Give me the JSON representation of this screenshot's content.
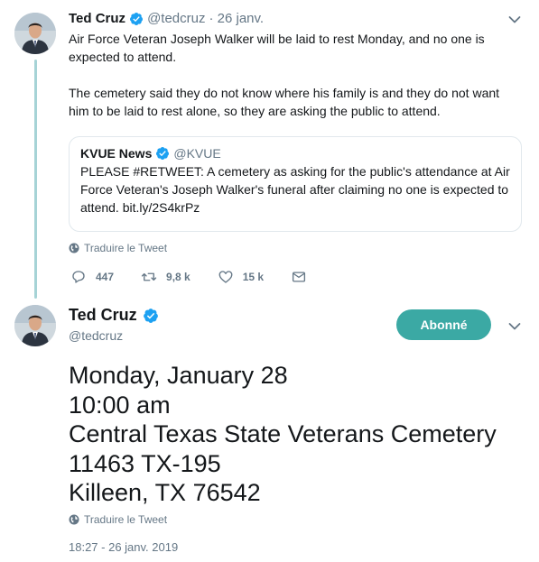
{
  "tweet1": {
    "author_name": "Ted Cruz",
    "author_handle": "@tedcruz",
    "date": "· 26 janv.",
    "verified_icon": "verified-badge",
    "paragraphs": [
      "Air Force Veteran Joseph Walker will be laid to rest Monday, and no one is expected to attend.",
      "The cemetery said they do not know where his family is and they do not want him to be laid to rest alone, so they are asking the public to attend."
    ],
    "quote": {
      "author_name": "KVUE News",
      "author_handle": "@KVUE",
      "text": "PLEASE #RETWEET: A cemetery as asking for the public's attendance at Air Force Veteran's Joseph Walker's funeral after claiming no one is expected to attend. bit.ly/2S4krPz"
    },
    "translate_label": "Traduire le Tweet",
    "actions": {
      "replies": "447",
      "retweets": "9,8 k",
      "likes": "15 k"
    }
  },
  "tweet2": {
    "author_name": "Ted Cruz",
    "author_handle": "@tedcruz",
    "follow_label": "Abonné",
    "lines": [
      "Monday, January 28",
      "10:00 am",
      "Central Texas State Veterans Cemetery",
      "11463 TX-195",
      "Killeen, TX 76542"
    ],
    "translate_label": "Traduire le Tweet",
    "timestamp": "18:27 - 26 janv. 2019"
  },
  "colors": {
    "accent": "#3ba9a4",
    "thread_line": "#a6d3d6",
    "verified": "#1da1f2",
    "muted": "#657786",
    "text": "#14171a"
  }
}
